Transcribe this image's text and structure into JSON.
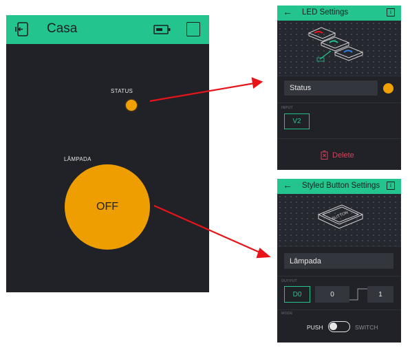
{
  "app": {
    "title": "Casa"
  },
  "dashboard": {
    "led_widget": {
      "label": "STATUS",
      "color": "#f0a000"
    },
    "button_widget": {
      "label": "LÂMPADA",
      "state": "OFF",
      "color": "#ee9e00"
    }
  },
  "led_settings": {
    "title": "LED Settings",
    "info_label": "i",
    "name_value": "Status",
    "color": "#f0a000",
    "input_section_label": "INPUT",
    "input_pin": "V2",
    "delete_label": "Delete"
  },
  "button_settings": {
    "title": "Styled Button Settings",
    "info_label": "i",
    "name_value": "Lâmpada",
    "output_section_label": "OUTPUT",
    "output_pin": "D0",
    "low_value": "0",
    "high_value": "1",
    "mode_section_label": "MODE",
    "mode_push": "PUSH",
    "mode_switch": "SWITCH",
    "mode_selected": "PUSH"
  },
  "colors": {
    "accent": "#23c48e",
    "background": "#212227",
    "danger": "#d3435c",
    "arrow": "#e8141a"
  }
}
